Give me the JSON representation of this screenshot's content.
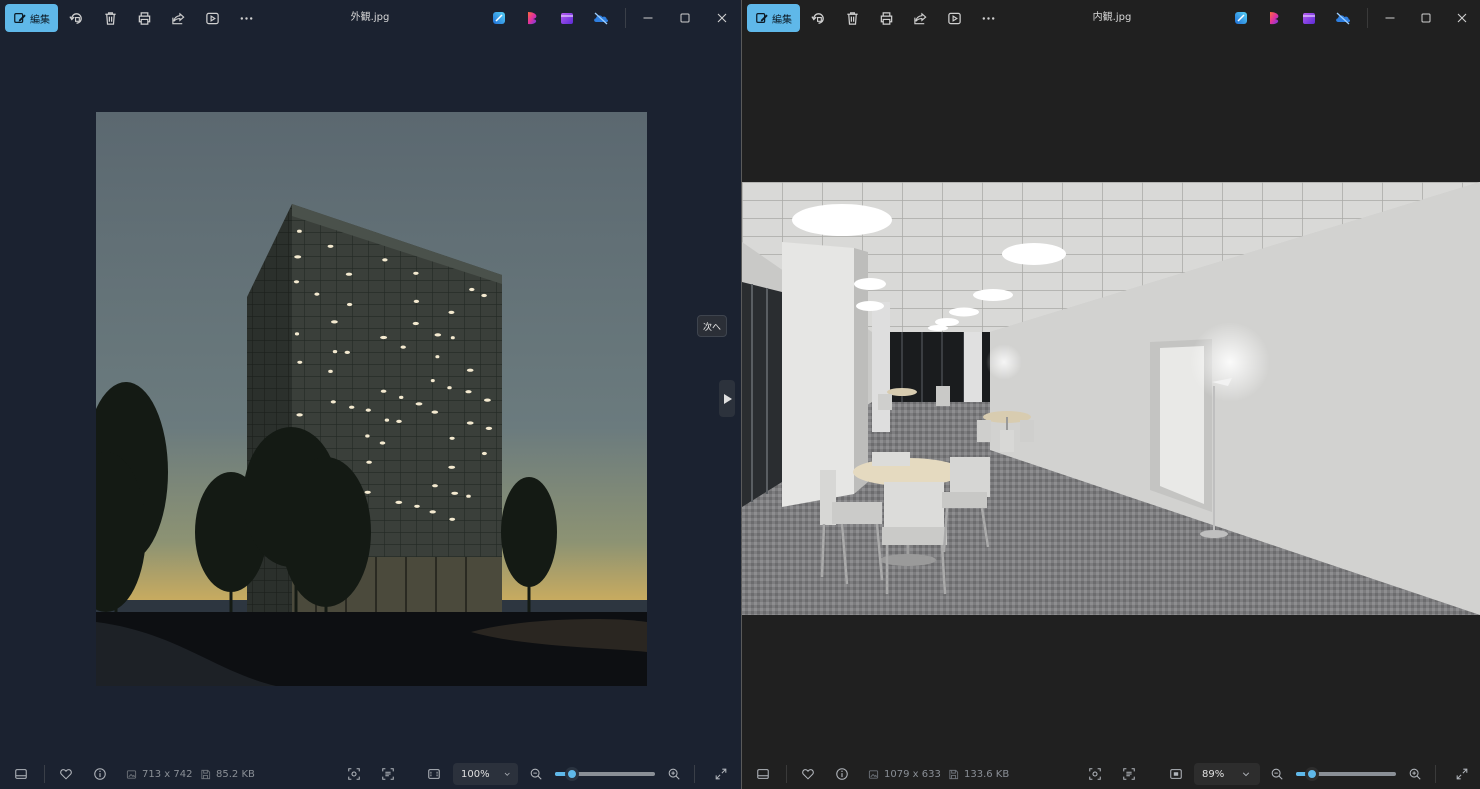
{
  "windows": [
    {
      "title": "外観.jpg",
      "edit_label": "編集",
      "tooltip_next": "次へ",
      "image": {
        "dimensions": "713 x 742",
        "file_size": "85.2 KB"
      },
      "zoom": {
        "label": "100%",
        "level": 0.17
      }
    },
    {
      "title": "内観.jpg",
      "edit_label": "編集",
      "image": {
        "dimensions": "1079 x 633",
        "file_size": "133.6 KB"
      },
      "zoom": {
        "label": "89%",
        "level": 0.16
      }
    }
  ],
  "colors": {
    "accent": "#5fb8e9",
    "window1_bg": "#1b2230",
    "window2_bg": "#202020"
  },
  "icons": {
    "toolbar": [
      "edit-icon",
      "rotate-icon",
      "delete-icon",
      "print-icon",
      "share-icon",
      "slideshow-icon",
      "more-icon"
    ],
    "apps": [
      "designer-icon",
      "clipchamp-icon",
      "video-app-icon",
      "onedrive-icon"
    ],
    "window_controls": [
      "minimize-icon",
      "maximize-icon",
      "close-icon"
    ],
    "status": [
      "filmstrip-icon",
      "favorite-icon",
      "info-icon",
      "dimensions-icon",
      "file-size-icon",
      "detect-icon",
      "ocr-icon",
      "fit-icon",
      "zoom-out-icon",
      "zoom-in-icon",
      "fullscreen-icon"
    ]
  }
}
